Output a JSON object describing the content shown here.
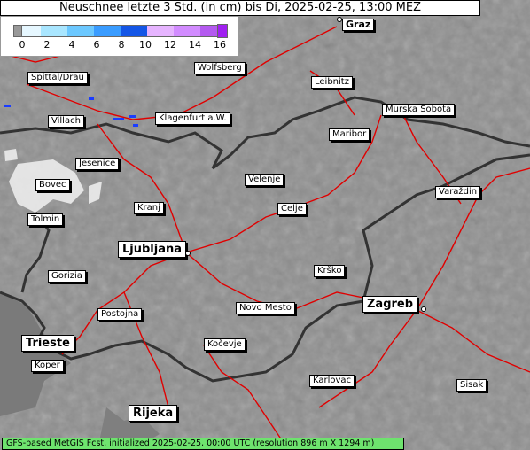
{
  "title": "Neuschnee letzte 3 Std. (in cm) bis Di, 2025-02-25, 13:00 MEZ",
  "legend": {
    "ticks": [
      "0",
      "2",
      "4",
      "6",
      "8",
      "10",
      "12",
      "14",
      "16"
    ],
    "colors": [
      "#e6f7ff",
      "#a9e6ff",
      "#6cc8ff",
      "#3a9cff",
      "#1456e6",
      "#e6b4ff",
      "#d28cff",
      "#b45af0",
      "#a020f0"
    ]
  },
  "cities": {
    "graz": "Graz",
    "wolfsberg": "Wolfsberg",
    "spittal": "Spittal/Drau",
    "leibnitz": "Leibnitz",
    "villach": "Villach",
    "klagenfurt": "Klagenfurt a.W.",
    "murska": "Murska Sobota",
    "maribor": "Maribor",
    "jesenice": "Jesenice",
    "bovec": "Bovec",
    "velenje": "Velenje",
    "varazdin": "Varaždin",
    "kranj": "Kranj",
    "celje": "Celje",
    "tolmin": "Tolmin",
    "ljubljana": "Ljubljana",
    "krsko": "Krško",
    "gorizia": "Gorizia",
    "zagreb": "Zagreb",
    "novomesto": "Novo Mesto",
    "postojna": "Postojna",
    "trieste": "Trieste",
    "kocevje": "Kočevje",
    "koper": "Koper",
    "karlovac": "Karlovac",
    "sisak": "Sisak",
    "rijeka": "Rijeka"
  },
  "footer": "GFS-based MetGIS Fcst, initialized 2025-02-25, 00:00 UTC  (resolution 896 m X 1294 m)"
}
